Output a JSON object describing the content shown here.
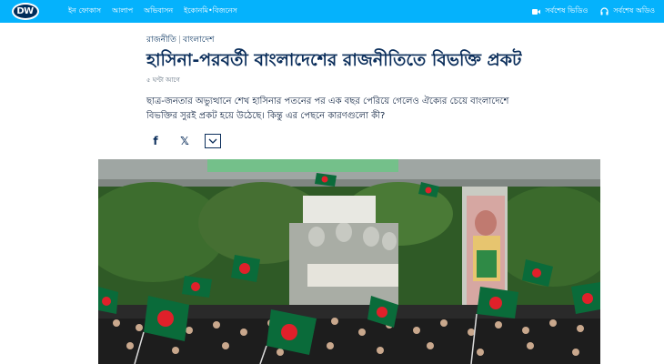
{
  "header": {
    "logo_text": "DW",
    "nav_items": [
      "ইন ফোকাস",
      "আলাপ",
      "অভিবাসন",
      "ইকোনমি•বিজনেস"
    ],
    "latest_video": "সর্বশেষ ভিডিও",
    "latest_audio": "সর্বশেষ অডিও"
  },
  "article": {
    "category": "রাজনীতি",
    "region": "বাংলাদেশ",
    "title": "হাসিনা-পরবর্তী বাংলাদেশের রাজনীতিতে বিভক্তি প্রকট",
    "time": "৫ ঘণ্টা আগে",
    "lead": "ছাত্র-জনতার অভ্যুত্থানে শেখ হাসিনার পতনের পর এক বছর পেরিয়ে গেলেও ঐক্যের চেয়ে বাংলাদেশে বিভক্তির সুরই প্রকট হয়ে উঠেছে। কিন্তু এর পেছনে কারণগুলো কী?"
  },
  "share": {
    "facebook": "f",
    "x": "𝕏",
    "more_icon": "chevron-down-icon"
  },
  "colors": {
    "topbar": "#05b2fc",
    "title": "#0b2e5b",
    "flag_green": "#0a6b3a",
    "flag_red": "#e0202a"
  }
}
